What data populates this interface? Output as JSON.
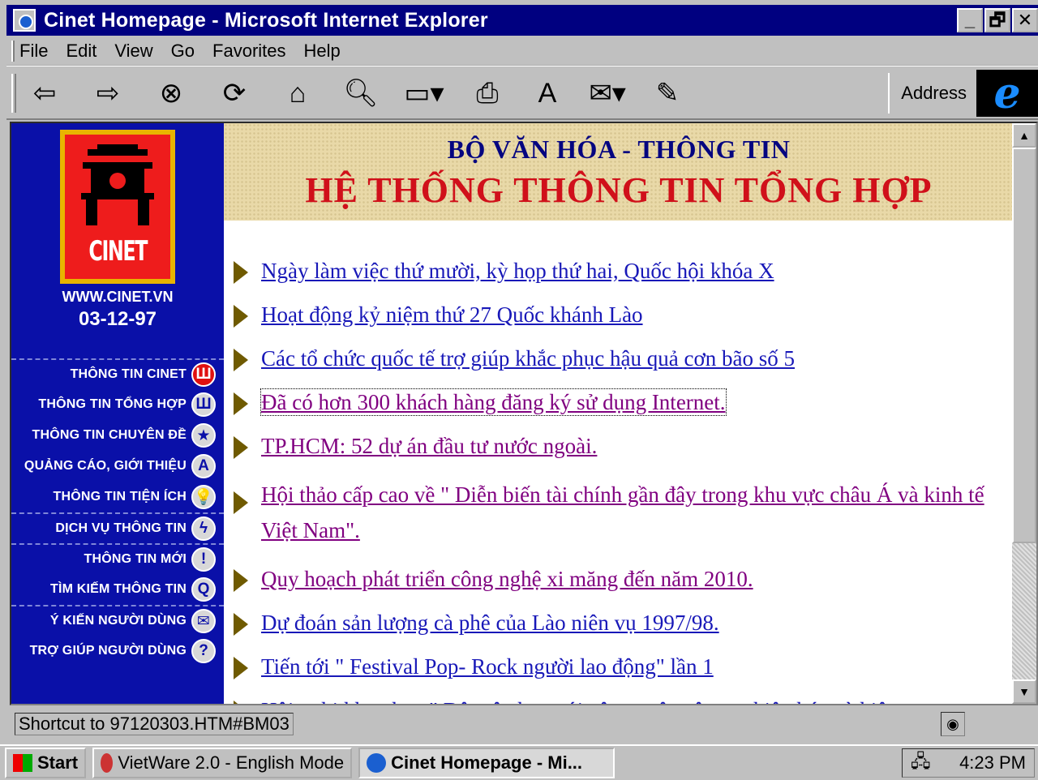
{
  "window": {
    "title": "Cinet Homepage - Microsoft Internet Explorer",
    "minimize": "_",
    "maximize": "🗗",
    "close": "✕"
  },
  "menu": [
    "File",
    "Edit",
    "View",
    "Go",
    "Favorites",
    "Help"
  ],
  "toolbar": {
    "address_label": "Address",
    "buttons": [
      "back-icon",
      "forward-icon",
      "stop-icon",
      "refresh-icon",
      "home-icon",
      "search-icon",
      "favorites-icon",
      "print-icon",
      "font-icon",
      "mail-icon",
      "edit-icon"
    ]
  },
  "sidebar": {
    "logo_text": "CINET",
    "url": "WWW.CINET.VN",
    "date": "03-12-97",
    "items": [
      {
        "label": "THÔNG TIN CINET",
        "icon": "Ш"
      },
      {
        "label": "THÔNG TIN TỔNG HỢP",
        "icon": "Ш"
      },
      {
        "label": "THÔNG TIN CHUYÊN ĐỀ",
        "icon": "★"
      },
      {
        "label": "QUẢNG CÁO, GIỚI THIỆU",
        "icon": "A"
      },
      {
        "label": "THÔNG TIN TIỆN ÍCH",
        "icon": "💡"
      },
      {
        "label": "DỊCH VỤ THÔNG TIN",
        "icon": "ϟ"
      },
      {
        "label": "THÔNG TIN MỚI",
        "icon": "!"
      },
      {
        "label": "TÌM KIẾM THÔNG TIN",
        "icon": "Q"
      },
      {
        "label": "Ý KIẾN NGƯỜI DÙNG",
        "icon": "✉"
      },
      {
        "label": "TRỢ GIÚP NGƯỜI DÙNG",
        "icon": "?"
      }
    ]
  },
  "banner": {
    "ministry": "BỘ VĂN HÓA - THÔNG TIN",
    "system": "HỆ THỐNG THÔNG TIN TỔNG HỢP"
  },
  "news": [
    {
      "text": "Ngày làm việc thứ mười, kỳ họp thứ hai, Quốc hội khóa X",
      "visited": false
    },
    {
      "text": "Hoạt động kỷ niệm thứ 27 Quốc khánh Lào",
      "visited": false
    },
    {
      "text": "Các tổ chức quốc tế trợ giúp khắc phục hậu quả cơn bão số 5",
      "visited": false
    },
    {
      "text": "Đã có hơn 300 khách hàng đăng ký sử dụng Internet.",
      "visited": true
    },
    {
      "text": "TP.HCM: 52 dự án đầu tư nước ngoài.",
      "visited": true
    },
    {
      "text": "Hội thảo cấp cao về \" Diễn biến tài chính gần đây trong khu vực châu Á và kinh tế Việt Nam\".",
      "visited": true
    },
    {
      "text": "Quy hoạch phát triển công nghệ xi măng đến năm 2010.",
      "visited": true
    },
    {
      "text": "Dự đoán sản lượng cà phê của Lào niên vụ 1997/98.",
      "visited": false
    },
    {
      "text": "Tiến tới \" Festival Pop- Rock người lao động\" lần 1",
      "visited": false
    },
    {
      "text": "Hội nghị khoa học \" Dân tộc học với công cuộc công nghiệp hóa và hiện",
      "visited": false
    }
  ],
  "status": {
    "text": "Shortcut to 97120303.HTM#BM03"
  },
  "taskbar": {
    "start": "Start",
    "tasks": [
      "VietWare 2.0 - English Mode",
      "Cinet Homepage - Mi..."
    ],
    "clock": "4:23 PM"
  }
}
